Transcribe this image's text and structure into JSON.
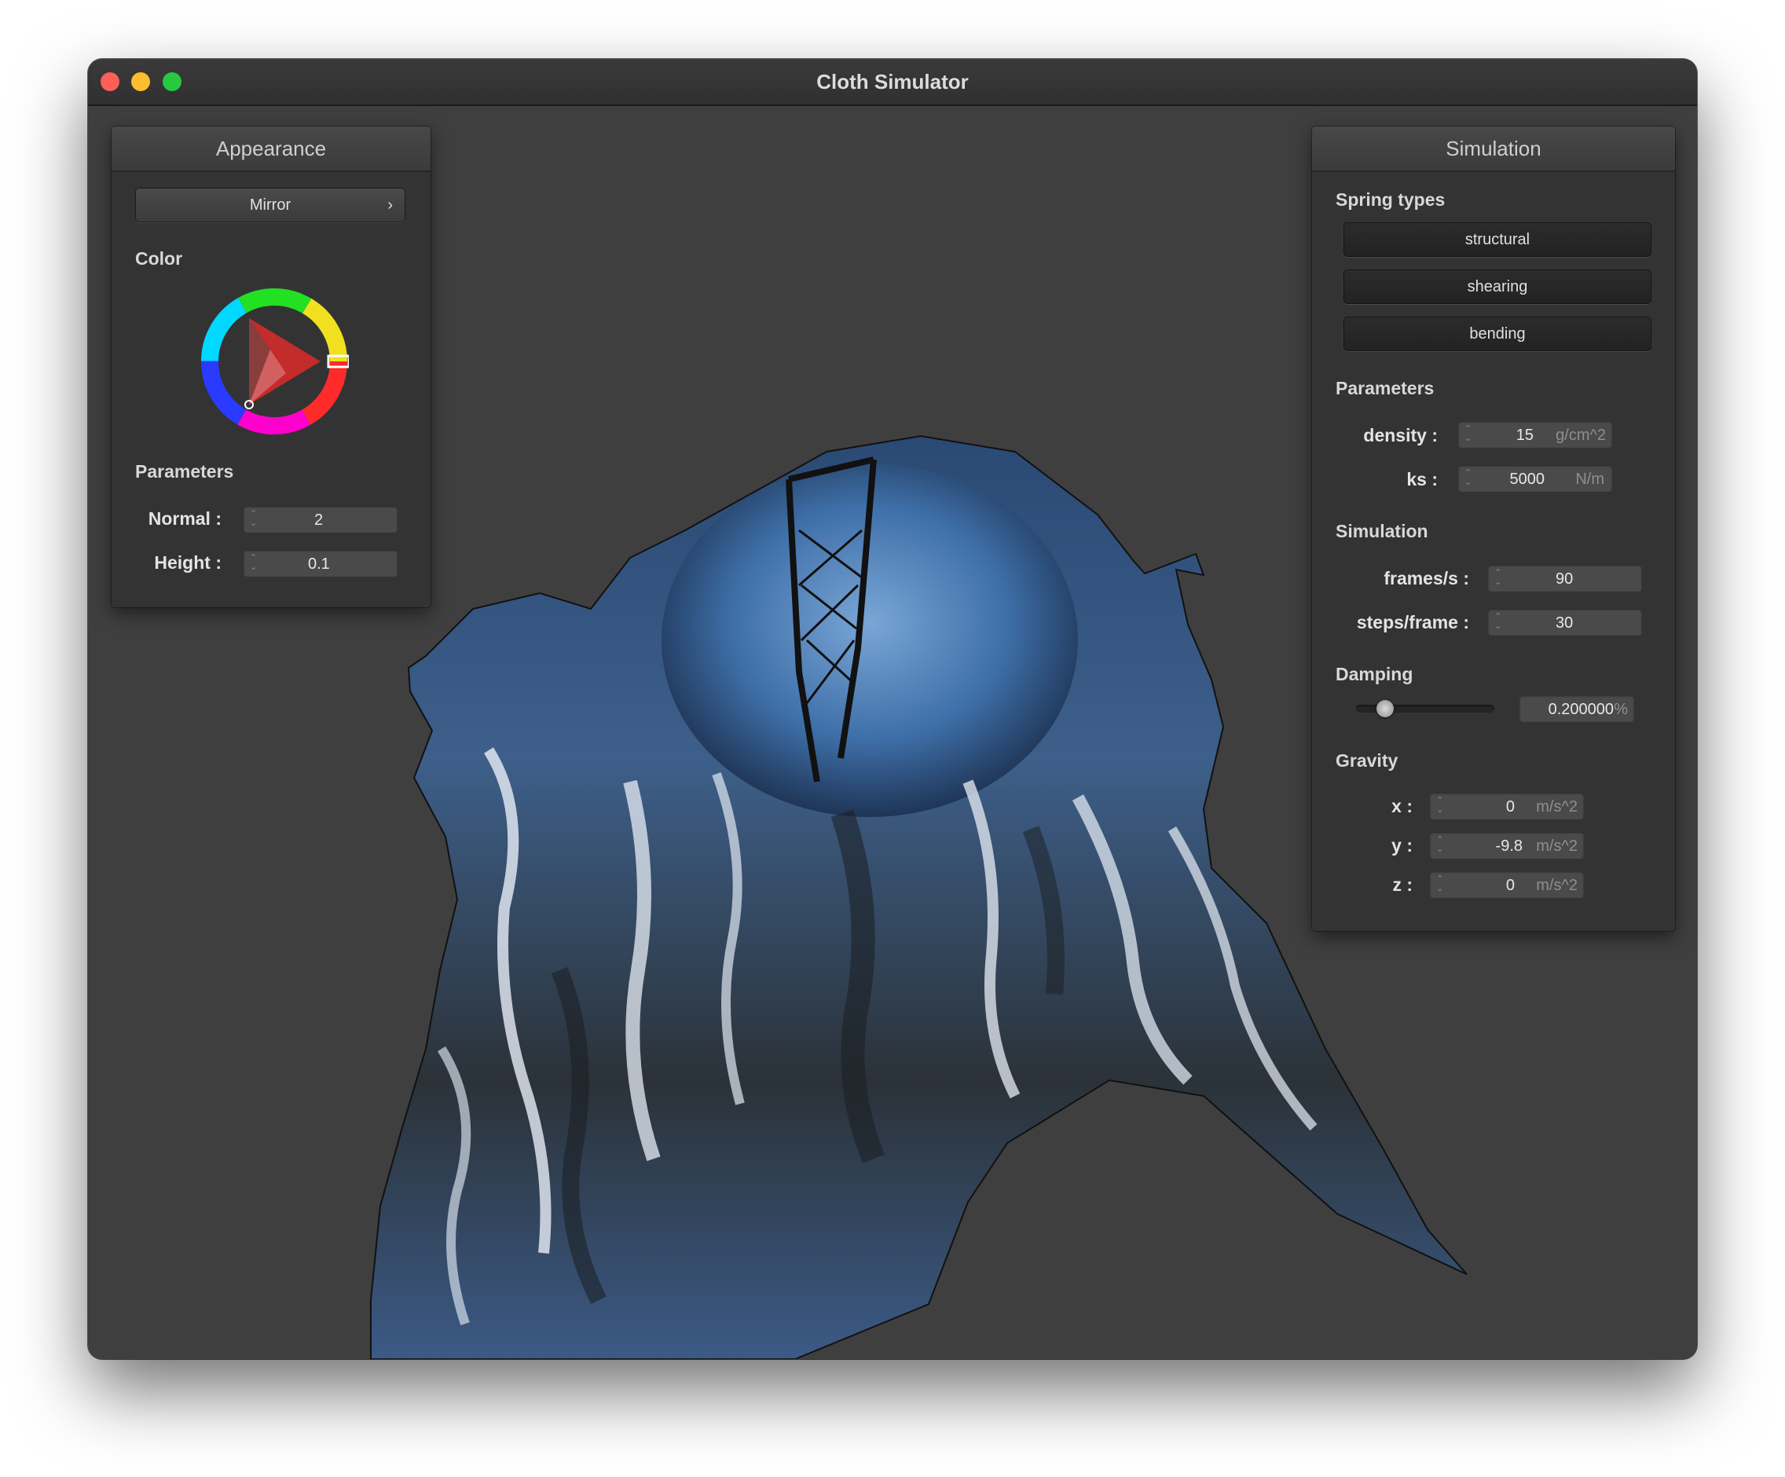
{
  "window": {
    "title": "Cloth Simulator"
  },
  "appearance": {
    "header": "Appearance",
    "shader_button": "Mirror",
    "shader_chevron": "›",
    "color_label": "Color",
    "color_value": "#d42a2a",
    "parameters_label": "Parameters",
    "normal_label": "Normal :",
    "normal_value": "2",
    "height_label": "Height :",
    "height_value": "0.1"
  },
  "simulation": {
    "header": "Simulation",
    "spring_types_label": "Spring types",
    "spring_buttons": [
      "structural",
      "shearing",
      "bending"
    ],
    "parameters_label": "Parameters",
    "density_label": "density :",
    "density_value": "15",
    "density_unit": "g/cm^2",
    "ks_label": "ks :",
    "ks_value": "5000",
    "ks_unit": "N/m",
    "simulation_label": "Simulation",
    "fps_label": "frames/s :",
    "fps_value": "90",
    "steps_label": "steps/frame :",
    "steps_value": "30",
    "damping_label": "Damping",
    "damping_value": "0.200000",
    "damping_unit": "%",
    "damping_level": 0.2,
    "gravity_label": "Gravity",
    "gx_label": "x :",
    "gx_value": "0",
    "gy_label": "y :",
    "gy_value": "-9.8",
    "gz_label": "z :",
    "gz_value": "0",
    "gravity_unit": "m/s^2"
  }
}
